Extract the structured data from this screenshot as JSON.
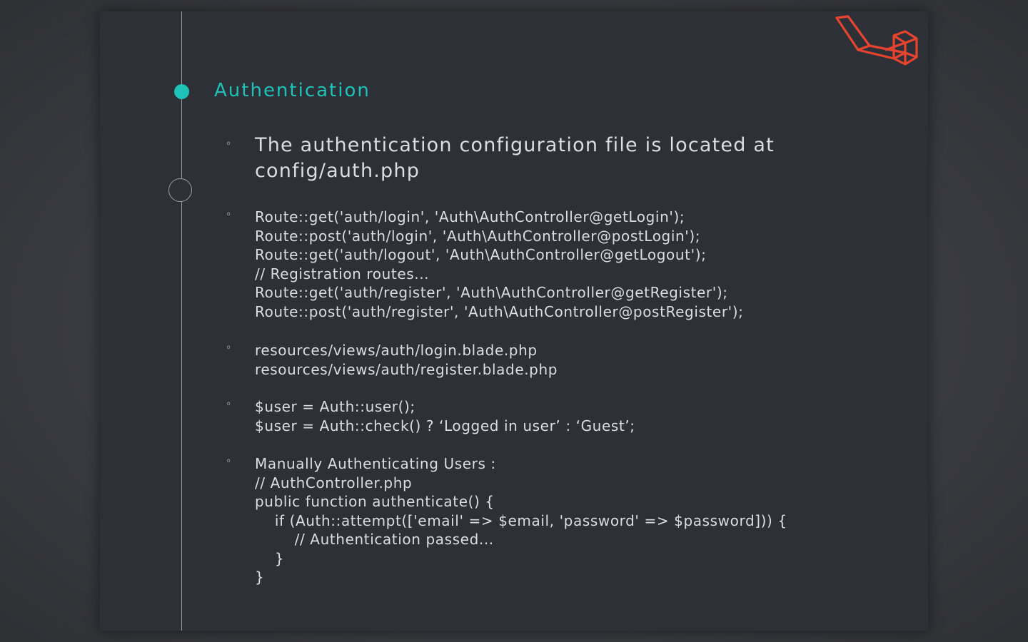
{
  "slide": {
    "title": "Authentication",
    "accent_color": "#1fc2b6",
    "logo_color": "#e74430",
    "logo_icon": "laravel-logo-icon",
    "bullet_marker": "◦",
    "bullets": [
      {
        "text": "The authentication configuration file is located at\nconfig/auth.php"
      },
      {
        "text": "Route::get('auth/login', 'Auth\\AuthController@getLogin');\nRoute::post('auth/login', 'Auth\\AuthController@postLogin');\nRoute::get('auth/logout', 'Auth\\AuthController@getLogout');\n// Registration routes...\nRoute::get('auth/register', 'Auth\\AuthController@getRegister');\nRoute::post('auth/register', 'Auth\\AuthController@postRegister');"
      },
      {
        "text": "resources/views/auth/login.blade.php\nresources/views/auth/register.blade.php"
      },
      {
        "text": "$user = Auth::user();\n$user = Auth::check() ? ‘Logged in user’ : ‘Guest’;"
      },
      {
        "text": "Manually Authenticating Users :\n// AuthController.php\npublic function authenticate() {\n    if (Auth::attempt(['email' => $email, 'password' => $password])) {\n        // Authentication passed...\n    }\n}"
      }
    ]
  }
}
